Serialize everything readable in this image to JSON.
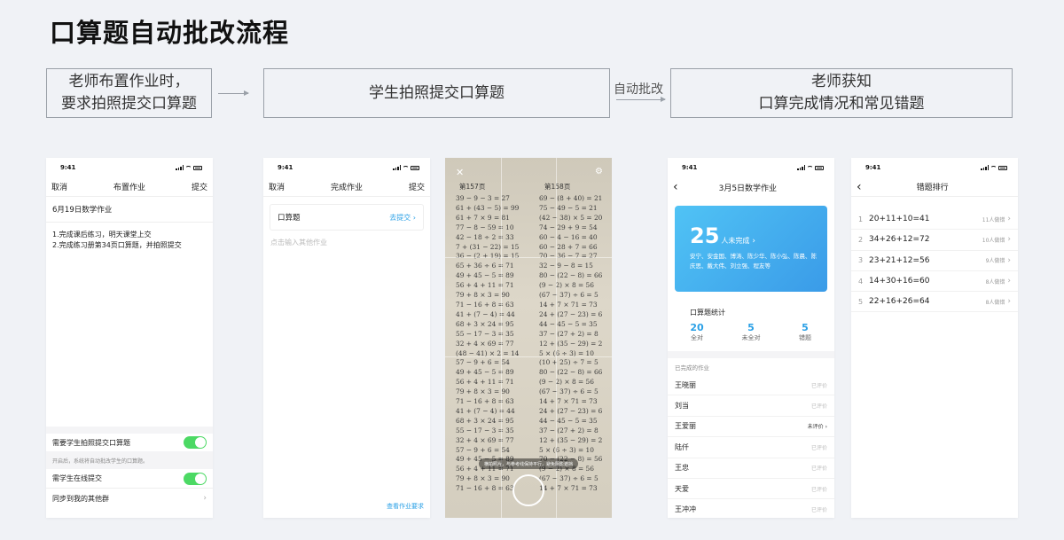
{
  "title": "口算题自动批改流程",
  "flow": {
    "step1_line1": "老师布置作业时，",
    "step1_line2": "要求拍照提交口算题",
    "step2": "学生拍照提交口算题",
    "arrow_label": "自动批改",
    "step3_line1": "老师获知",
    "step3_line2": "口算完成情况和常见错题"
  },
  "status_time": "9:41",
  "phone1": {
    "cancel": "取消",
    "title": "布置作业",
    "submit": "提交",
    "hw_title": "6月19日数学作业",
    "line1": "1.完成课后练习，明天课堂上交",
    "line2": "2.完成练习册第34页口算题，并拍照提交",
    "toggle1_label": "需要学生拍照提交口算题",
    "toggle1_note": "开启后，系统将自动批改学生的口算题。",
    "toggle2_label": "需学生在线提交",
    "sync_label": "同步到我的其他群"
  },
  "phone2": {
    "cancel": "取消",
    "title": "完成作业",
    "submit": "提交",
    "item_label": "口算题",
    "item_action": "去提交",
    "placeholder": "点击输入其他作业",
    "footer_link": "查看作业要求"
  },
  "camera": {
    "page_left": "第157页",
    "page_right": "第158页",
    "tip": "横拍照片，与参考线保持平行，避免阴影遮挡"
  },
  "phone4": {
    "title": "3月5日数学作业",
    "unfinished_count": "25",
    "unfinished_label": "人未完成",
    "names": "安宁、安金国、博涛、陈少华、陈小弘、陈晨、陈庆思、戴大伟、刘立强、程友等",
    "stats_title": "口算题统计",
    "stats": [
      {
        "num": "20",
        "label": "全对"
      },
      {
        "num": "5",
        "label": "未全对"
      },
      {
        "num": "5",
        "label": "错题"
      }
    ],
    "done_label": "已完成的作业",
    "students": [
      {
        "name": "王晓丽",
        "status": "已评价"
      },
      {
        "name": "刘当",
        "status": "已评价"
      },
      {
        "name": "王爱丽",
        "status": "未评价"
      },
      {
        "name": "陆仟",
        "status": "已评价"
      },
      {
        "name": "王忠",
        "status": "已评价"
      },
      {
        "name": "天爱",
        "status": "已评价"
      },
      {
        "name": "王冲冲",
        "status": "已评价"
      }
    ]
  },
  "phone5": {
    "title": "错题排行",
    "errors": [
      {
        "rank": "1",
        "eq": "20+11+10=41",
        "count": "11人做错"
      },
      {
        "rank": "2",
        "eq": "34+26+12=72",
        "count": "10人做错"
      },
      {
        "rank": "3",
        "eq": "23+21+12=56",
        "count": "9人做错"
      },
      {
        "rank": "4",
        "eq": "14+30+16=60",
        "count": "8人做错"
      },
      {
        "rank": "5",
        "eq": "22+16+26=64",
        "count": "8人做错"
      }
    ]
  }
}
